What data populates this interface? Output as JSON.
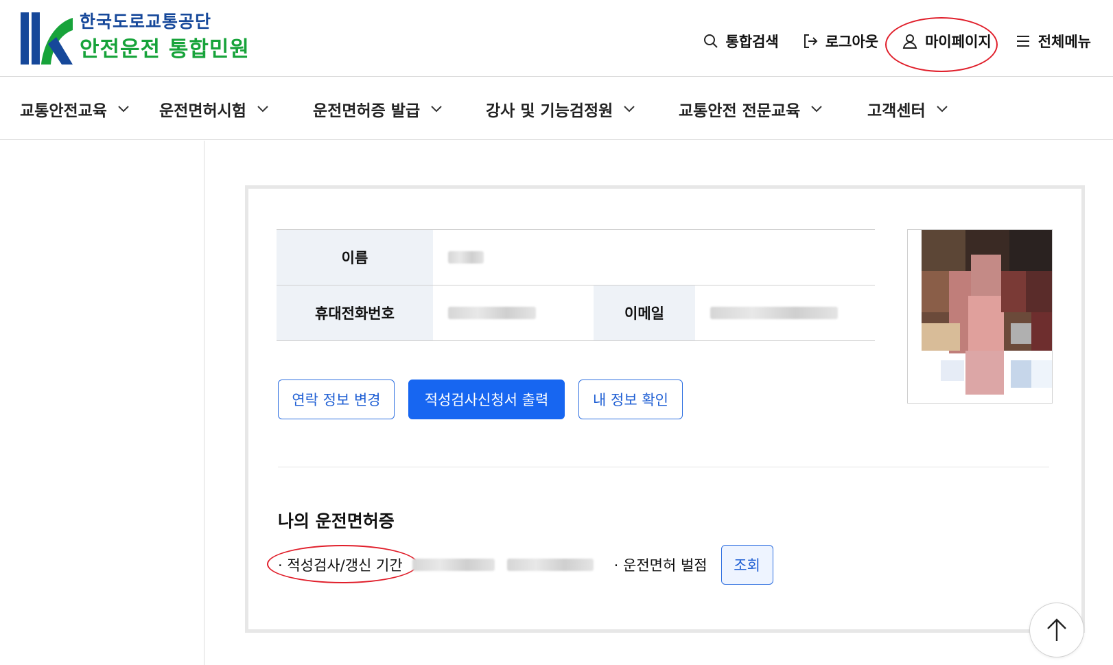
{
  "brand": {
    "org_name": "한국도로교통공단",
    "service_name": "안전운전 통합민원",
    "colors": {
      "blue": "#16489a",
      "green": "#17a33a"
    }
  },
  "util_nav": [
    {
      "label": "통합검색",
      "icon": "search-icon"
    },
    {
      "label": "로그아웃",
      "icon": "logout-icon"
    },
    {
      "label": "마이페이지",
      "icon": "user-icon",
      "highlighted": true
    },
    {
      "label": "전체메뉴",
      "icon": "hamburger-icon"
    }
  ],
  "gnb": [
    {
      "label": "교통안전교육"
    },
    {
      "label": "운전면허시험"
    },
    {
      "label": "운전면허증 발급"
    },
    {
      "label": "강사 및 기능검정원"
    },
    {
      "label": "교통안전 전문교육"
    },
    {
      "label": "고객센터"
    }
  ],
  "profile": {
    "name_label": "이름",
    "phone_label": "휴대전화번호",
    "email_label": "이메일",
    "values_obscured": true
  },
  "actions": {
    "change_contact": "연락 정보 변경",
    "print_application": "적성검사신청서 출력",
    "check_my_info": "내 정보 확인"
  },
  "license": {
    "section_title": "나의 운전면허증",
    "period_label": "· 적성검사/갱신 기간",
    "penalty_label": "· 운전면허 벌점",
    "query_button": "조회"
  },
  "colors": {
    "primary": "#1766f1",
    "annotation": "#e01e2a",
    "table_header_bg": "#eef2f7"
  }
}
